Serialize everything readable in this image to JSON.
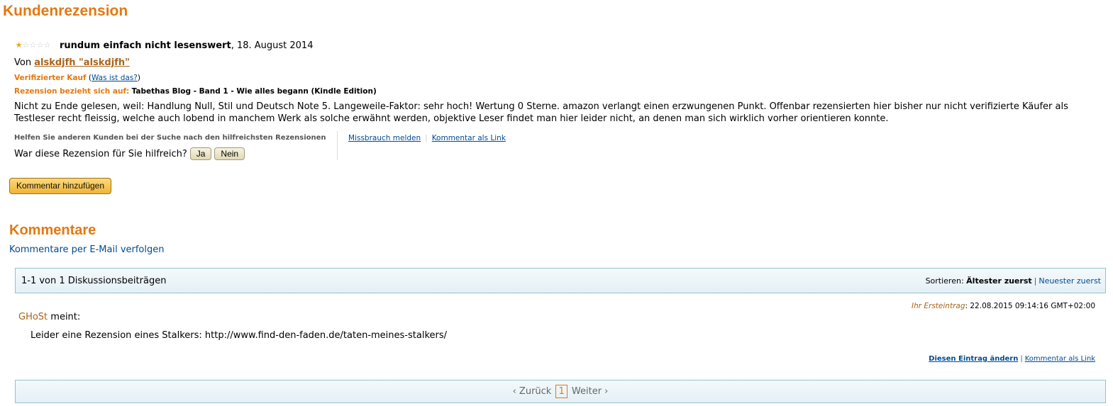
{
  "page": {
    "title": "Kundenrezension"
  },
  "review": {
    "rating": 1,
    "max_rating": 5,
    "title": "rundum einfach nicht lesenswert",
    "date": ", 18. August 2014",
    "by_prefix": "Von ",
    "author": "alskdjfh \"alskdjfh\"",
    "verified_label": "Verifizierter Kauf",
    "what_is_this": "Was ist das?",
    "refers_label": "Rezension bezieht sich auf:",
    "product": "Tabethas Blog - Band 1 - Wie alles begann (Kindle Edition)",
    "body": "Nicht zu Ende gelesen, weil: Handlung Null, Stil und Deutsch Note 5. Langeweile-Faktor: sehr hoch! Wertung 0 Sterne. amazon verlangt einen erzwungenen Punkt. Offenbar rezensierten hier bisher nur nicht verifizierte Käufer als Testleser recht fleissig, welche auch lobend in manchem Werk als solche erwähnt werden, objektive Leser findet man hier leider nicht, an denen man sich wirklich vorher orientieren konnte."
  },
  "helpful": {
    "label": "Helfen Sie anderen Kunden bei der Suche nach den hilfreichsten Rezensionen",
    "question": "War diese Rezension für Sie hilfreich?",
    "yes": "Ja",
    "no": "Nein",
    "report": "Missbrauch melden",
    "comment_link": "Kommentar als Link"
  },
  "add_comment": "Kommentar hinzufügen",
  "comments": {
    "title": "Kommentare",
    "follow": "Kommentare per E-Mail verfolgen",
    "count": "1-1 von 1 Diskussionsbeiträgen",
    "sort_label": "Sortieren:",
    "sort_oldest": "Ältester zuerst",
    "sort_newest": "Neuester zuerst",
    "items": [
      {
        "first_entry_label": "Ihr Ersteintrag",
        "timestamp": ": 22.08.2015 09:14:16 GMT+02:00",
        "author": "GHoSt",
        "says": " meint:",
        "body": "Leider eine Rezension eines Stalkers: http://www.find-den-faden.de/taten-meines-stalkers/",
        "edit": "Diesen Eintrag ändern",
        "link": "Kommentar als Link"
      }
    ]
  },
  "pager": {
    "prev": "‹ Zurück",
    "current": "1",
    "next": "Weiter ›"
  },
  "colors": {
    "accent": "#e47911",
    "link": "#004b91",
    "author": "#a9641c"
  }
}
